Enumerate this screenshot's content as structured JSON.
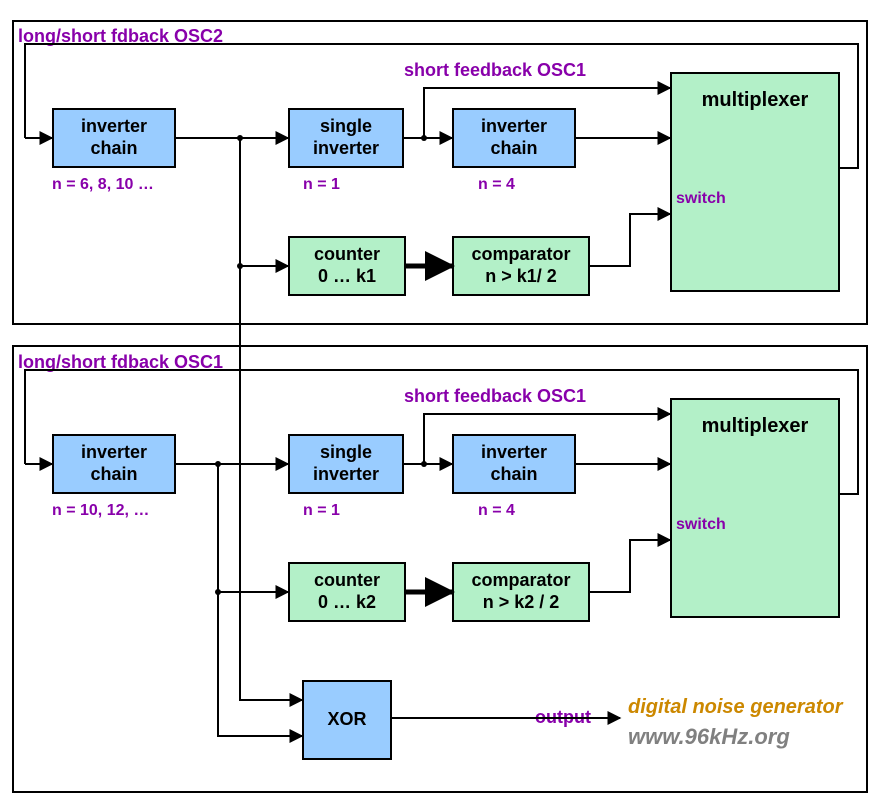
{
  "title_top": "long/short fdback OSC2",
  "title_mid": "long/short fdback OSC1",
  "short_fb_top": "short feedback OSC1",
  "short_fb_mid": "short feedback OSC1",
  "blocks": {
    "inv_chain_top": {
      "l1": "inverter",
      "l2": "chain",
      "note": "n =  6, 8, 10 …"
    },
    "single_inv_top": {
      "l1": "single",
      "l2": "inverter",
      "note": "n =  1"
    },
    "inv_chain2_top": {
      "l1": "inverter",
      "l2": "chain",
      "note": "n =  4"
    },
    "mux_top": {
      "l1": "multiplexer",
      "switch": "switch"
    },
    "counter_top": {
      "l1": "counter",
      "l2": "0 … k1"
    },
    "comp_top": {
      "l1": "comparator",
      "l2": "n > k1/ 2"
    },
    "inv_chain_bot": {
      "l1": "inverter",
      "l2": "chain",
      "note": "n =  10, 12, …"
    },
    "single_inv_bot": {
      "l1": "single",
      "l2": "inverter",
      "note": "n =  1"
    },
    "inv_chain2_bot": {
      "l1": "inverter",
      "l2": "chain",
      "note": "n = 4"
    },
    "mux_bot": {
      "l1": "multiplexer",
      "switch": "switch"
    },
    "counter_bot": {
      "l1": "counter",
      "l2": "0 … k2"
    },
    "comp_bot": {
      "l1": "comparator",
      "l2": "n > k2 / 2"
    },
    "xor": {
      "l1": "XOR"
    }
  },
  "output_label": "output",
  "brand1": "digital noise generator",
  "brand2": "www.96kHz.org"
}
